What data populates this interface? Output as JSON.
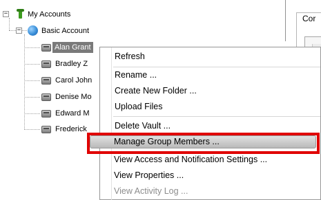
{
  "tree": {
    "root": {
      "label": "My Accounts",
      "toggle": "−"
    },
    "account": {
      "label": "Basic Account",
      "toggle": "−"
    },
    "vaults": [
      {
        "label": "Alan Grant",
        "selected": true
      },
      {
        "label": "Bradley Z"
      },
      {
        "label": "Carol John"
      },
      {
        "label": "Denise Mo"
      },
      {
        "label": "Edward M"
      },
      {
        "label": "Frederick"
      }
    ],
    "icons": {
      "root": "accounts-icon",
      "account": "globe-icon",
      "vault": "vault-icon"
    }
  },
  "right_panel": {
    "group_label_fragment": "Cor",
    "fragment_2": "e"
  },
  "context_menu": {
    "items": [
      {
        "label": "Refresh"
      },
      {
        "label": "Rename ..."
      },
      {
        "label": "Create New Folder ..."
      },
      {
        "label": "Upload Files"
      },
      {
        "label": "Delete Vault ..."
      },
      {
        "label": "Manage Group Members ...",
        "highlighted": true
      },
      {
        "label": "View Access and Notification Settings ..."
      },
      {
        "label": "View Properties ..."
      },
      {
        "label": "View Activity Log ...",
        "disabled": true
      }
    ],
    "highlight_color": "#e00000"
  }
}
